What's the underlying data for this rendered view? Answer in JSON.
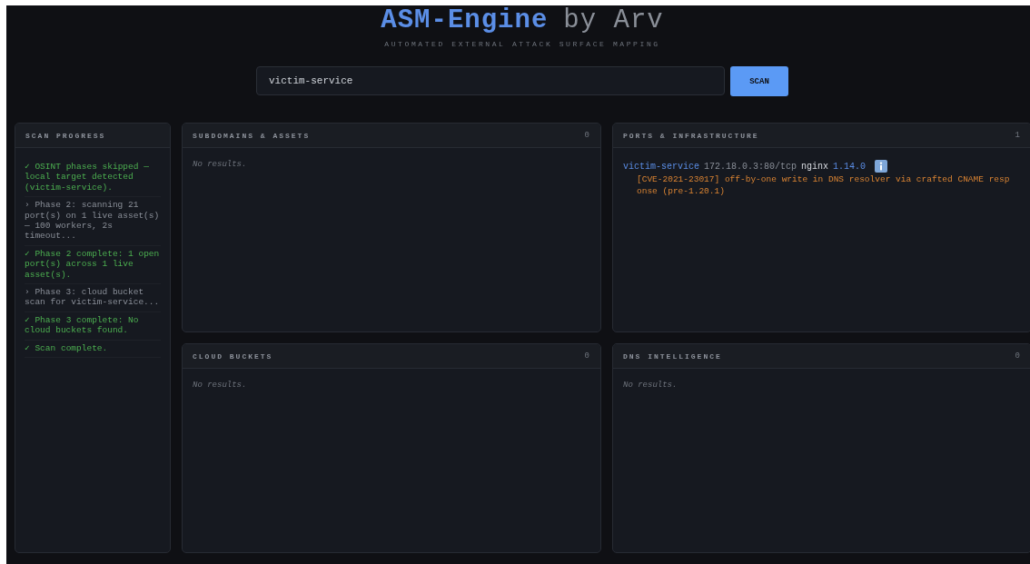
{
  "header": {
    "title_main": "ASM-Engine",
    "title_suffix": "by Arv",
    "subtitle": "AUTOMATED EXTERNAL ATTACK SURFACE MAPPING"
  },
  "search": {
    "value": "victim-service",
    "button": "SCAN"
  },
  "progress": {
    "title": "SCAN PROGRESS",
    "entries": [
      {
        "kind": "success",
        "marker": "✓",
        "text": "OSINT phases skipped — local target detected (victim-service)."
      },
      {
        "kind": "info",
        "marker": "›",
        "text": "Phase 2: scanning 21 port(s) on 1 live asset(s) — 100 workers, 2s timeout..."
      },
      {
        "kind": "success",
        "marker": "✓",
        "text": "Phase 2 complete: 1 open port(s) across 1 live asset(s)."
      },
      {
        "kind": "info",
        "marker": "›",
        "text": "Phase 3: cloud bucket scan for victim-service..."
      },
      {
        "kind": "success",
        "marker": "✓",
        "text": "Phase 3 complete: No cloud buckets found."
      },
      {
        "kind": "success",
        "marker": "✓",
        "text": "Scan complete."
      }
    ]
  },
  "panels": [
    {
      "title": "SUBDOMAINS & ASSETS",
      "count": "0",
      "empty": "No results."
    },
    {
      "title": "PORTS & INFRASTRUCTURE",
      "count": "1",
      "ports": [
        {
          "host": "victim-service",
          "address": "172.18.0.3:80/tcp",
          "service": "nginx",
          "version": "1.14.0",
          "vulns": [
            "[CVE-2021-23017] off-by-one write in DNS resolver via crafted CNAME response (pre-1.20.1)"
          ]
        }
      ]
    },
    {
      "title": "CLOUD BUCKETS",
      "count": "0",
      "empty": "No results."
    },
    {
      "title": "DNS INTELLIGENCE",
      "count": "0",
      "empty": "No results."
    }
  ]
}
